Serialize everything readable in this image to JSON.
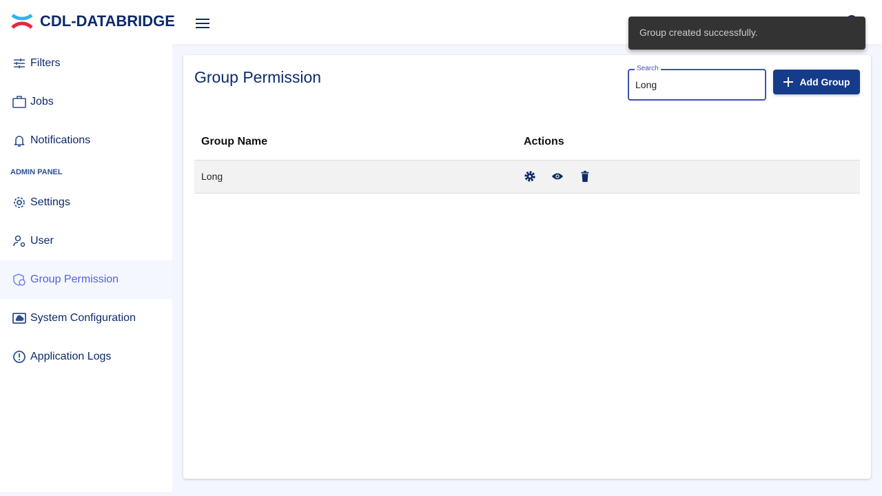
{
  "app": {
    "brand": "CDL-DATABRIDGE"
  },
  "sidebar": {
    "items": [
      {
        "label": "Filters"
      },
      {
        "label": "Jobs"
      },
      {
        "label": "Notifications"
      }
    ],
    "section": "ADMIN PANEL",
    "admin_items": [
      {
        "label": "Settings"
      },
      {
        "label": "User"
      },
      {
        "label": "Group Permission"
      },
      {
        "label": "System Configuration"
      },
      {
        "label": "Application Logs"
      }
    ]
  },
  "main": {
    "title": "Group Permission",
    "search": {
      "label": "Search",
      "value": "Long"
    },
    "add_label": "Add Group",
    "columns": [
      "Group Name",
      "Actions"
    ],
    "rows": [
      {
        "name": "Long"
      }
    ]
  },
  "toast": {
    "message": "Group created successfully."
  },
  "colors": {
    "primary": "#0d2a6b",
    "accent": "#143c8a",
    "active": "#5360e0"
  }
}
